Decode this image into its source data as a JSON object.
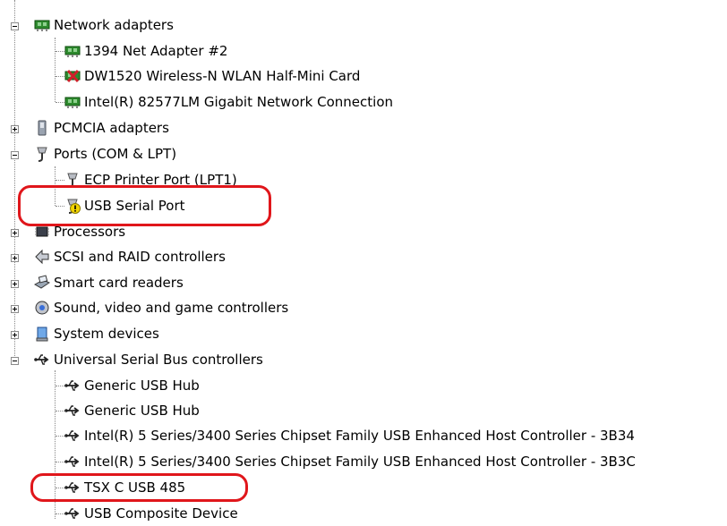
{
  "tree": {
    "network_adapters": {
      "label": "Network adapters",
      "children": [
        "1394 Net Adapter #2",
        "DW1520 Wireless-N WLAN Half-Mini Card",
        "Intel(R) 82577LM Gigabit Network Connection"
      ]
    },
    "pcmcia": {
      "label": "PCMCIA adapters"
    },
    "ports": {
      "label": "Ports (COM & LPT)",
      "children": [
        "ECP Printer Port (LPT1)",
        "USB Serial Port"
      ]
    },
    "processors": {
      "label": "Processors"
    },
    "scsi": {
      "label": "SCSI and RAID controllers"
    },
    "smart_card": {
      "label": "Smart card readers"
    },
    "sound": {
      "label": "Sound, video and game controllers"
    },
    "system": {
      "label": "System devices"
    },
    "usb": {
      "label": "Universal Serial Bus controllers",
      "children": [
        "Generic USB Hub",
        "Generic USB Hub",
        "Intel(R) 5 Series/3400 Series Chipset Family USB Enhanced Host Controller - 3B34",
        "Intel(R) 5 Series/3400 Series Chipset Family USB Enhanced Host Controller - 3B3C",
        "TSX C USB 485",
        "USB Composite Device"
      ]
    }
  },
  "colors": {
    "highlight": "#e0161b",
    "warning": "#f2d400",
    "disabled": "#d0202a"
  }
}
